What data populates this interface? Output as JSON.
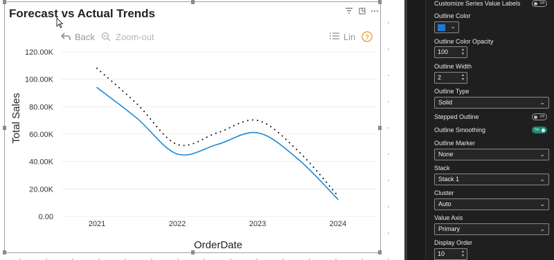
{
  "visual": {
    "title": "Forecast vs Actual Trends",
    "toolbar": {
      "back_label": "Back",
      "zoom_out_label": "Zoom-out",
      "lin_label": "Lin",
      "help_label": "?"
    },
    "header_icons": [
      "filter-icon",
      "focus-mode-icon",
      "more-options-icon"
    ]
  },
  "chart_data": {
    "type": "line",
    "xlabel": "OrderDate",
    "ylabel": "Total Sales",
    "categories": [
      "2021",
      "2022",
      "2023",
      "2024"
    ],
    "y_ticks": [
      "0.00",
      "20.00K",
      "40.00K",
      "60.00K",
      "80.00K",
      "100.00K",
      "120.00K"
    ],
    "ylim": [
      0,
      120000
    ],
    "grid": true,
    "series": [
      {
        "style": "solid",
        "color": "#1a8ad4",
        "x": [
          2021,
          2021.5,
          2022,
          2022.5,
          2023,
          2023.5,
          2024
        ],
        "values": [
          94000,
          71500,
          45500,
          52500,
          61000,
          42000,
          12500
        ]
      },
      {
        "style": "dotted",
        "color": "#111111",
        "x": [
          2021,
          2021.5,
          2022,
          2022.5,
          2023,
          2023.5,
          2024
        ],
        "values": [
          108000,
          82000,
          52500,
          61000,
          70000,
          48000,
          15000
        ]
      }
    ]
  },
  "format_pane": {
    "customize_series_label": "Customize Series Value Labels",
    "customize_series_toggle": "Off",
    "outline_color_label": "Outline Color",
    "outline_color_value": "#1f78d1",
    "outline_opacity_label": "Outline Color Opacity",
    "outline_opacity_value": "100",
    "outline_width_label": "Outline Width",
    "outline_width_value": "2",
    "outline_type_label": "Outline Type",
    "outline_type_value": "Solid",
    "stepped_outline_label": "Stepped Outline",
    "stepped_outline_toggle": "Off",
    "outline_smoothing_label": "Outline Smoothing",
    "outline_smoothing_toggle": "On",
    "outline_marker_label": "Outline Marker",
    "outline_marker_value": "None",
    "stack_label": "Stack",
    "stack_value": "Stack 1",
    "cluster_label": "Cluster",
    "cluster_value": "Auto",
    "value_axis_label": "Value Axis",
    "value_axis_value": "Primary",
    "display_order_label": "Display Order",
    "display_order_value": "10"
  }
}
